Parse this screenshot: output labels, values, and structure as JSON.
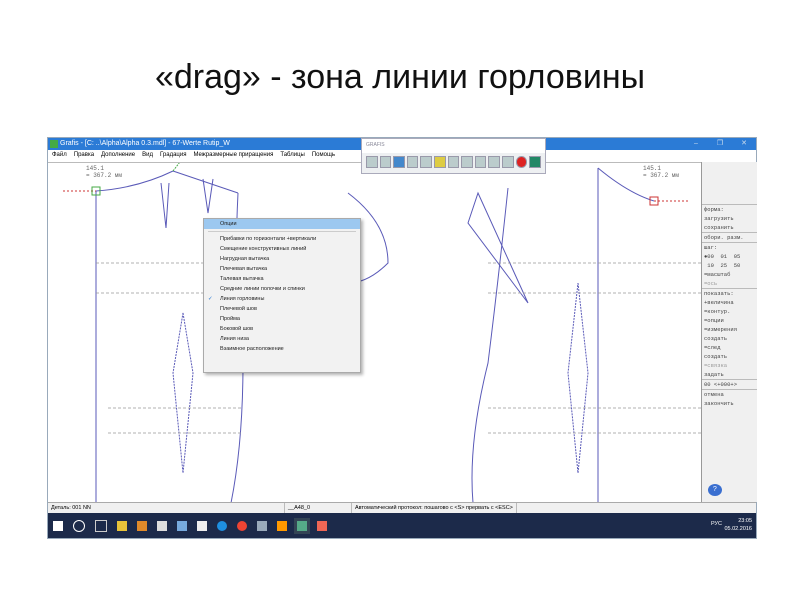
{
  "slide": {
    "title": "«drag» - зона линии горловины"
  },
  "window": {
    "title": "Grafis - [C: ..\\Alpha\\Alpha 0.3.mdl] - 67-Werte Rutip_W",
    "minimize": "–",
    "maximize": "❐",
    "close": "✕"
  },
  "menu": [
    "Файл",
    "Правка",
    "Дополнение",
    "Вид",
    "Градация",
    "Межразмерные приращения",
    "Таблицы",
    "Помощь"
  ],
  "toolbar": {
    "title": "GRAFIS"
  },
  "readout": {
    "left": [
      "145.1",
      "= 367.2 мм"
    ],
    "right": [
      "145.1",
      "= 367.2 мм"
    ]
  },
  "context_menu": {
    "items": [
      {
        "label": "Опции",
        "highlighted": true
      },
      {
        "label": "Прибавки по горизонтали +вертикали"
      },
      {
        "label": "Смещение конструктивных линий"
      },
      {
        "label": "Нагрудная вытачка"
      },
      {
        "label": "Плечевая вытачка"
      },
      {
        "label": "Талевая вытачка"
      },
      {
        "label": "Средние линии полочки и спинки"
      },
      {
        "label": "Линия горловины",
        "checked": true
      },
      {
        "label": "Плечевой шов"
      },
      {
        "label": "Пройма"
      },
      {
        "label": "Боковой шов"
      },
      {
        "label": "Линия низа"
      },
      {
        "label": "Взаимное расположение"
      }
    ],
    "check": "✓"
  },
  "panel": {
    "form": "форма:",
    "load": "загрузить",
    "save": "сохранить",
    "sizes": "обори. разм.",
    "step": "шаг:",
    "step_row1": "●00  01  05",
    "step_row2": " 10  25  50",
    "scale": "=масштаб",
    "axis": "=ось",
    "show": "показать:",
    "value": "+величина",
    "contour": "=контур.",
    "options": "=опции",
    "measure": "=измерения",
    "measure_create": "создать",
    "trace": "=след",
    "trace_create": "создать",
    "link": "=связка",
    "link_set": "задать",
    "coords": "00 <+000+>",
    "cancel": "отмена",
    "finish": "закончить",
    "help": "?"
  },
  "status": {
    "detail": "Деталь: 001  NN",
    "code": "__A48_0",
    "protocol": "Автоматический протокол: пошагово с <S> прервать с <ESC>"
  },
  "taskbar": {
    "lang": "РУС",
    "time": "23:05",
    "date": "05.02.2016"
  }
}
